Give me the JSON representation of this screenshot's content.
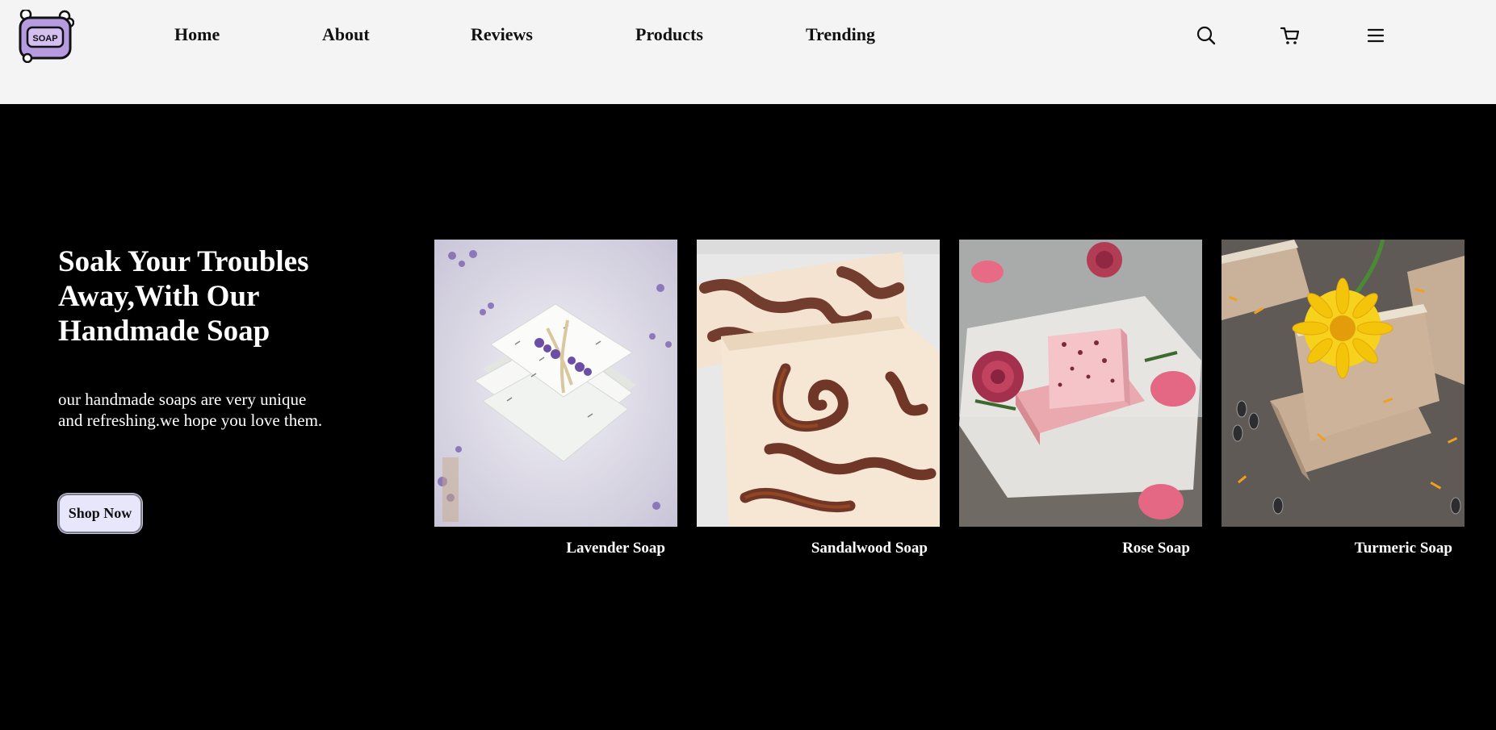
{
  "header": {
    "logo_text": "SOAP",
    "nav": [
      {
        "label": "Home"
      },
      {
        "label": "About"
      },
      {
        "label": "Reviews"
      },
      {
        "label": "Products"
      },
      {
        "label": "Trending"
      }
    ],
    "icons": [
      "search-icon",
      "cart-icon",
      "menu-icon"
    ]
  },
  "hero": {
    "title": "Soak Your Troubles Away,With Our Handmade Soap",
    "description": "our handmade soaps are very unique and refreshing.we hope you love them.",
    "cta_label": "Shop Now"
  },
  "products": [
    {
      "name": "Lavender Soap"
    },
    {
      "name": "Sandalwood Soap"
    },
    {
      "name": "Rose Soap"
    },
    {
      "name": "Turmeric Soap"
    }
  ],
  "colors": {
    "header_bg": "#f4f4f4",
    "hero_bg": "#000000",
    "button_bg": "#e8e6fb",
    "logo_purple": "#b79be0"
  }
}
